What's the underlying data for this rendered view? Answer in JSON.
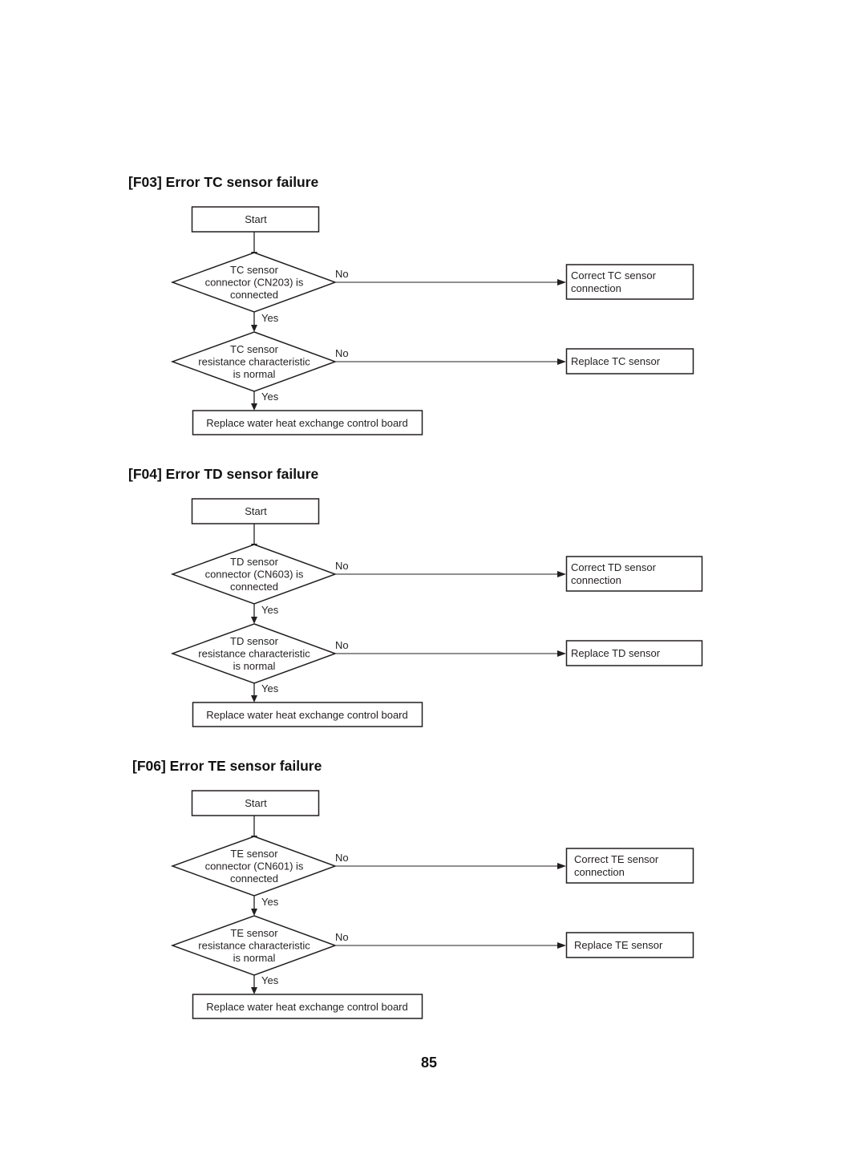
{
  "page": {
    "page_number": "85"
  },
  "sections": [
    {
      "title": "[F03] Error TC sensor failure",
      "start": "Start",
      "decision1": [
        "TC sensor",
        "connector (CN203) is",
        "connected"
      ],
      "decision2": [
        "TC sensor",
        "resistance characteristic",
        "is normal"
      ],
      "no_label": "No",
      "yes_label": "Yes",
      "action_no1": [
        "Correct TC sensor",
        "connection"
      ],
      "action_no2": "Replace TC sensor",
      "action_yes": "Replace water heat exchange control board"
    },
    {
      "title": "[F04] Error TD sensor failure",
      "start": "Start",
      "decision1": [
        "TD sensor",
        "connector (CN603) is",
        "connected"
      ],
      "decision2": [
        "TD sensor",
        "resistance characteristic",
        "is normal"
      ],
      "no_label": "No",
      "yes_label": "Yes",
      "action_no1": [
        "Correct TD sensor",
        "connection"
      ],
      "action_no2": "Replace TD sensor",
      "action_yes": "Replace water heat exchange control board"
    },
    {
      "title": "[F06] Error TE sensor failure",
      "start": "Start",
      "decision1": [
        "TE sensor",
        "connector (CN601) is",
        "connected"
      ],
      "decision2": [
        "TE sensor",
        "resistance characteristic",
        "is normal"
      ],
      "no_label": "No",
      "yes_label": "Yes",
      "action_no1": [
        "Correct TE sensor",
        "connection"
      ],
      "action_no2": "Replace TE sensor",
      "action_yes": "Replace water heat exchange control board"
    }
  ]
}
